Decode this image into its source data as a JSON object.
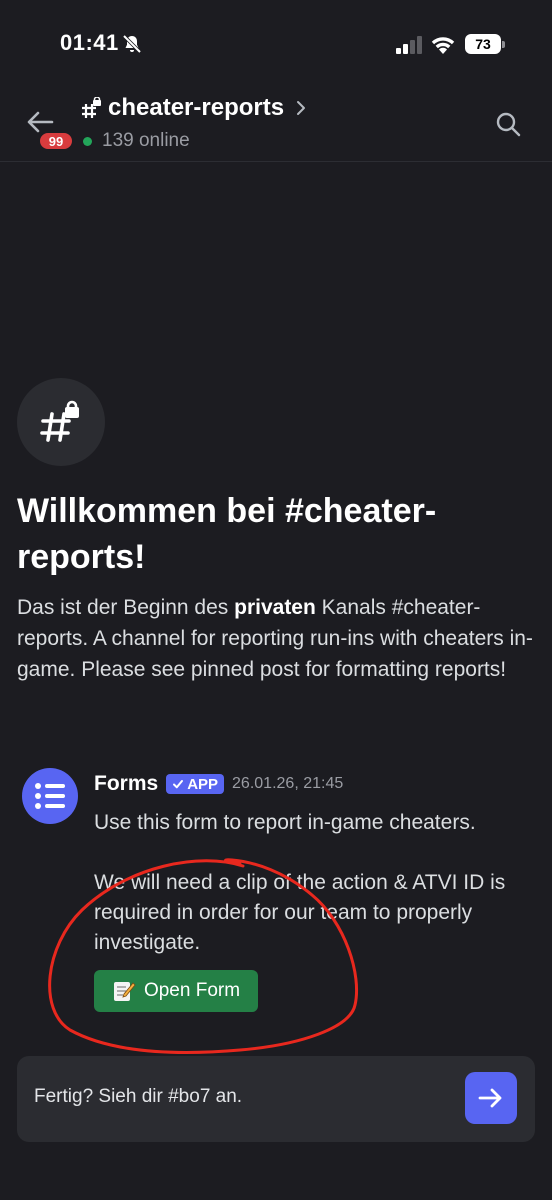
{
  "status_bar": {
    "time": "01:41",
    "battery": "73",
    "icons": [
      "bell-slash-icon",
      "signal-icon",
      "wifi-icon",
      "battery-icon"
    ]
  },
  "header": {
    "back_icon": "arrow-left-icon",
    "unread_badge": "99",
    "channel_name": "cheater-reports",
    "channel_icon": "hash-lock-icon",
    "online_count": "139 online",
    "search_icon": "search-icon"
  },
  "welcome": {
    "title": "Willkommen bei #cheater-reports!",
    "desc_pre": "Das ist der Beginn des ",
    "desc_bold": "privaten",
    "desc_post": " Kanals #cheater-reports. A channel for reporting run-ins with cheaters in-game. Please see pinned post for formatting reports!"
  },
  "message": {
    "author": "Forms",
    "app_tag": "APP",
    "timestamp": "26.01.26, 21:45",
    "line1": "Use this form to report in-game cheaters.",
    "line2": "We will need a clip of the action & ATVI ID is required in order for our team to properly investigate.",
    "button_label": "Open Form"
  },
  "input": {
    "placeholder": "Fertig? Sieh dir #bo7 an.",
    "send_icon": "arrow-right-icon"
  },
  "colors": {
    "background": "#1c1c21",
    "blurple": "#5865f2",
    "green_button": "#248046",
    "badge_red": "#d83c3e",
    "annotation_red": "#e8281e"
  }
}
